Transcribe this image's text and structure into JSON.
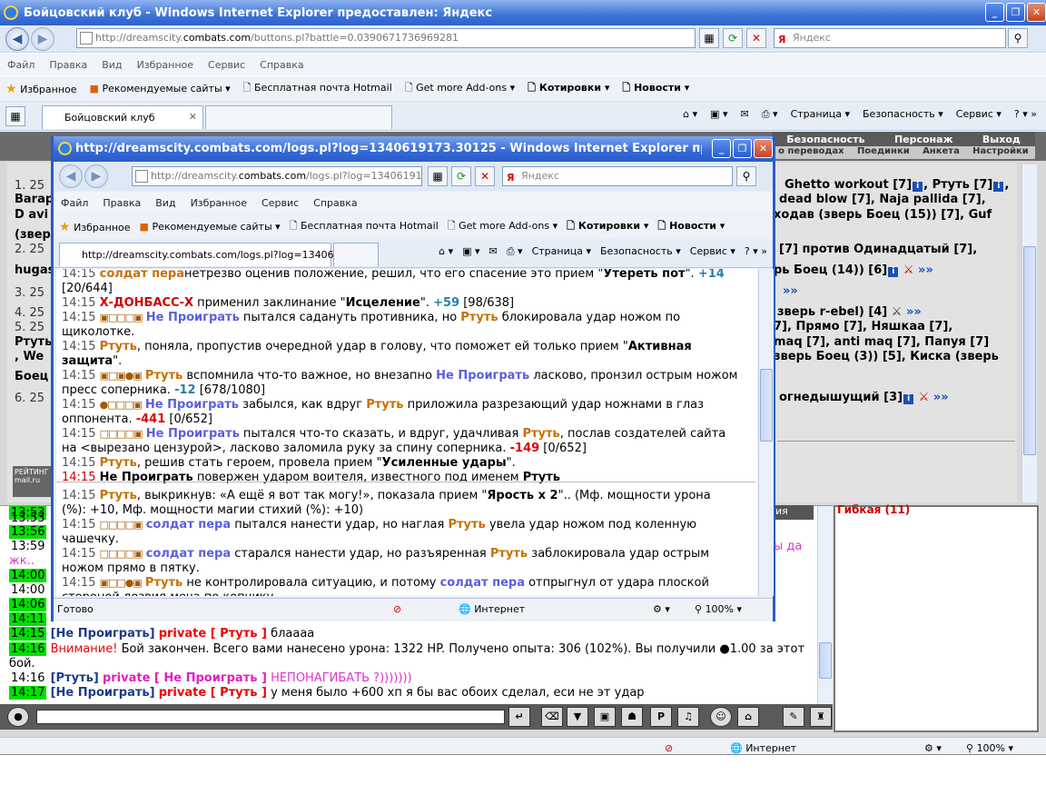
{
  "main_window": {
    "title": "Бойцовский клуб - Windows Internet Explorer предоставлен: Яндекс",
    "address_prefix": "http://dreamscity.",
    "address_domain": "combats.com",
    "address_suffix": "/buttons.pl?battle=0.0390671736969281",
    "search_placeholder": "Яндекс",
    "menu": [
      "Файл",
      "Правка",
      "Вид",
      "Избранное",
      "Сервис",
      "Справка"
    ],
    "favorites": [
      "Избранное",
      "Рекомендуемые сайты ▾",
      "Бесплатная почта Hotmail",
      "Get more Add-ons ▾",
      "Котировки ▾",
      "Новости ▾"
    ],
    "tab_label": "Бойцовский клуб",
    "toolbar_items": [
      "Страница ▾",
      "Безопасность ▾",
      "Сервис ▾"
    ],
    "status_zone": "Интернет",
    "zoom": "100%"
  },
  "game_nav": {
    "row1": [
      "Безопасность",
      "Персонаж",
      "Выход"
    ],
    "row2": [
      "о переводах",
      "Поединки",
      "Анкета",
      "Настройки"
    ]
  },
  "page_lines": [
    {
      "num": "1. 25",
      "text": "Ghetto workout [7]",
      "extra": ", Ртуть [7]"
    },
    {
      "num": "",
      "text": "Barap",
      "extra": "dead blow [7], Naja pallida [7],"
    },
    {
      "num": "",
      "text": "D avi",
      "extra": "ходав (зверь Боец (15)) [7], Guf"
    },
    {
      "num": "",
      "text": "(звер",
      "extra": ""
    },
    {
      "num": "2. 25",
      "text": "[7] против Одинадцатый [7],",
      "extra": ""
    },
    {
      "num": "",
      "text": "hugas",
      "extra": "рь Боец (14)) [6]"
    },
    {
      "num": "3. 25",
      "text": "»»",
      "extra": ""
    },
    {
      "num": "4. 25",
      "text": "зверь r-ebel) [4]",
      "extra": "»»"
    },
    {
      "num": "5. 25",
      "text": "7], Прямо [7], Няшкаа [7],",
      "extra": ""
    },
    {
      "num": "",
      "text": "Ртуть",
      "extra": "maq [7], anti maq [7], Папуя [7]"
    },
    {
      "num": "",
      "text": ", We",
      "extra": "зверь Боец (3)) [5], Киска (зверь"
    },
    {
      "num": "",
      "text": "Боец",
      "extra": ""
    },
    {
      "num": "6. 25",
      "text": "огнедышущий [3]",
      "extra": "»»"
    }
  ],
  "rating": "РЕЙТИНГ mail.ru",
  "chat": [
    {
      "ts": "13:53",
      "a": "",
      "b": "",
      "c": ""
    },
    {
      "ts": "13:56",
      "a": "",
      "b": "",
      "c": ""
    },
    {
      "ts": "13:59",
      "a": "",
      "b": "",
      "c": "ы да"
    },
    {
      "ts": "",
      "a": "жк..",
      "b": "",
      "c": ""
    },
    {
      "ts": "14:00",
      "a": "",
      "b": "",
      "c": ""
    },
    {
      "ts": "14:00",
      "a": "",
      "b": "",
      "c": ""
    },
    {
      "ts": "14:06",
      "a": "",
      "b": "",
      "c": ""
    },
    {
      "ts": "14:11",
      "a": "",
      "b": "",
      "c": ""
    },
    {
      "ts": "14:15",
      "a": "[Не Проиграть]",
      "b": "private [ Ртуть ]",
      "c": "блаааа"
    },
    {
      "ts": "14:16",
      "a": "Внимание!",
      "b": "Бой закончен. Всего вами нанесено урона: 1322 HP. Получено опыта: 306 (102%). Вы получили ●1.00 за этот",
      "c": ""
    },
    {
      "ts": "",
      "a": "бой.",
      "b": "",
      "c": ""
    },
    {
      "ts": "14:16",
      "a": "[Ртуть]",
      "b": "private [ Не Проиграть ]",
      "c": "НЕПОНАГИБАТЬ ?)))))))"
    },
    {
      "ts": "14:17",
      "a": "[Не Проиграть]",
      "b": "private [ Ртуть ]",
      "c": "у меня было +600 хп я бы вас обоих сделал, еси не эт удар"
    }
  ],
  "chat_tab_label": "ения",
  "chat_right_top": "Гибкая (11)",
  "popup": {
    "title": "http://dreamscity.combats.com/logs.pl?log=1340619173.30125 - Windows Internet Explorer предоставлен: ...",
    "address_prefix": "http://dreamscity.",
    "address_domain": "combats.com",
    "address_suffix": "/logs.pl?log=1340619173.:",
    "search_placeholder": "Яндекс",
    "menu": [
      "Файл",
      "Правка",
      "Вид",
      "Избранное",
      "Сервис",
      "Справка"
    ],
    "favorites": [
      "Избранное",
      "Рекомендуемые сайты ▾",
      "Бесплатная почта Hotmail",
      "Get more Add-ons ▾",
      "Котировки ▾",
      "Новости ▾"
    ],
    "tab_label": "http://dreamscity.combats.com/logs.pl?log=1340619...",
    "toolbar_items": [
      "Страница ▾",
      "Безопасность ▾",
      "Сервис ▾"
    ],
    "status_left": "Готово",
    "status_zone": "Интернет",
    "zoom": "100%"
  },
  "log": [
    {
      "t": "14:15",
      "html": [
        [
          "gold",
          "солдат пера"
        ],
        [
          "",
          "нетрезво оценив положение, решил, что его спасение это прием \""
        ],
        [
          "bk",
          "Утереть пот"
        ],
        [
          "",
          "\". "
        ],
        [
          "teal",
          "+14"
        ]
      ]
    },
    {
      "t": "",
      "html": [
        [
          "",
          "[20/644]"
        ]
      ]
    },
    {
      "t": "14:15",
      "html": [
        [
          "rdb",
          "Х-ДОНБАСС-Х"
        ],
        [
          "",
          " применил заклинание \""
        ],
        [
          "bk",
          "Исцеление"
        ],
        [
          "",
          "\". "
        ],
        [
          "teal",
          "+59"
        ],
        [
          "",
          " [98/638]"
        ]
      ]
    },
    {
      "t": "14:15",
      "dots": "▣□□□▣",
      "html": [
        [
          "lav",
          "Не Проиграть"
        ],
        [
          "",
          " пытался садануть противника, но "
        ],
        [
          "gold",
          "Ртуть"
        ],
        [
          "",
          " блокировала удар ножом по"
        ]
      ]
    },
    {
      "t": "",
      "html": [
        [
          "",
          "щиколотке."
        ]
      ]
    },
    {
      "t": "14:15",
      "html": [
        [
          "gold",
          "Ртуть"
        ],
        [
          "",
          ", поняла, пропустив очередной удар в голову, что поможет ей только прием \""
        ],
        [
          "bk",
          "Активная"
        ]
      ]
    },
    {
      "t": "",
      "html": [
        [
          "bk",
          "защита"
        ],
        [
          "",
          "\"."
        ]
      ]
    },
    {
      "t": "14:15",
      "dots": "▣□▣●▣",
      "html": [
        [
          "gold",
          "Ртуть"
        ],
        [
          "",
          " вспомнила что-то важное, но внезапно "
        ],
        [
          "lav",
          "Не Проиграть"
        ],
        [
          "",
          " ласково, пронзил острым ножом"
        ]
      ]
    },
    {
      "t": "",
      "html": [
        [
          "",
          "пресс соперника. "
        ],
        [
          "teal",
          "-12"
        ],
        [
          "",
          " [678/1080]"
        ]
      ]
    },
    {
      "t": "14:15",
      "dots": "●□□□▣",
      "html": [
        [
          "lav",
          "Не Проиграть"
        ],
        [
          "",
          " забылся, как вдруг "
        ],
        [
          "gold",
          "Ртуть"
        ],
        [
          "",
          " приложила разрезающий удар ножнами в глаз"
        ]
      ]
    },
    {
      "t": "",
      "html": [
        [
          "",
          "оппонента. "
        ],
        [
          "rd",
          "-441"
        ],
        [
          "",
          " [0/652]"
        ]
      ]
    },
    {
      "t": "14:15",
      "dots": "□□□□▣",
      "html": [
        [
          "lav",
          "Не Проиграть"
        ],
        [
          "",
          " пытался что-то сказать, и вдруг, удачливая "
        ],
        [
          "gold",
          "Ртуть"
        ],
        [
          "",
          ", послав создателей сайта"
        ]
      ]
    },
    {
      "t": "",
      "html": [
        [
          "",
          "на <вырезано цензурой>, ласково заломила руку за спину соперника. "
        ],
        [
          "rd",
          "-149"
        ],
        [
          "",
          " [0/652]"
        ]
      ]
    },
    {
      "t": "14:15",
      "html": [
        [
          "gold",
          "Ртуть"
        ],
        [
          "",
          ", решив стать героем, провела прием \""
        ],
        [
          "bk",
          "Усиленные удары"
        ],
        [
          "",
          "\"."
        ]
      ]
    },
    {
      "t": "14:15",
      "red": true,
      "html": [
        [
          "bk",
          "Не Проиграть"
        ],
        [
          "",
          " повержен ударом воителя, известного под именем "
        ],
        [
          "bk",
          "Ртуть"
        ]
      ]
    },
    {
      "t": "14:15",
      "html": [
        [
          "gold",
          "Ртуть"
        ],
        [
          "",
          ", выкрикнув: «А ещё я вот так могу!», показала прием \""
        ],
        [
          "bk",
          "Ярость x 2"
        ],
        [
          "",
          "\".. (Мф. мощности урона"
        ]
      ]
    },
    {
      "t": "",
      "html": [
        [
          "",
          "(%): +10, Мф. мощности магии стихий (%): +10)"
        ]
      ]
    },
    {
      "t": "14:15",
      "dots": "□□□□▣",
      "html": [
        [
          "lav",
          "солдат пера"
        ],
        [
          "",
          " пытался нанести удар, но наглая "
        ],
        [
          "gold",
          "Ртуть"
        ],
        [
          "",
          " увела удар ножом под коленную"
        ]
      ]
    },
    {
      "t": "",
      "html": [
        [
          "",
          "чашечку."
        ]
      ]
    },
    {
      "t": "14:15",
      "dots": "□□□□▣",
      "html": [
        [
          "lav",
          "солдат пера"
        ],
        [
          "",
          " старался нанести удар, но разъяренная "
        ],
        [
          "gold",
          "Ртуть"
        ],
        [
          "",
          " заблокировала удар острым"
        ]
      ]
    },
    {
      "t": "",
      "html": [
        [
          "",
          "ножом прямо в пятку."
        ]
      ]
    },
    {
      "t": "14:15",
      "dots": "▣□□●▣",
      "html": [
        [
          "gold",
          "Ртуть"
        ],
        [
          "",
          " не контролировала ситуацию, и потому "
        ],
        [
          "lav",
          "солдат пера"
        ],
        [
          "",
          " отпрыгнул от удара плоской"
        ]
      ]
    },
    {
      "t": "",
      "html": [
        [
          "",
          "стороной лезвия меча по копчику."
        ]
      ]
    }
  ],
  "bottom_status": {
    "zone": "Интернет",
    "zoom": "100%"
  }
}
